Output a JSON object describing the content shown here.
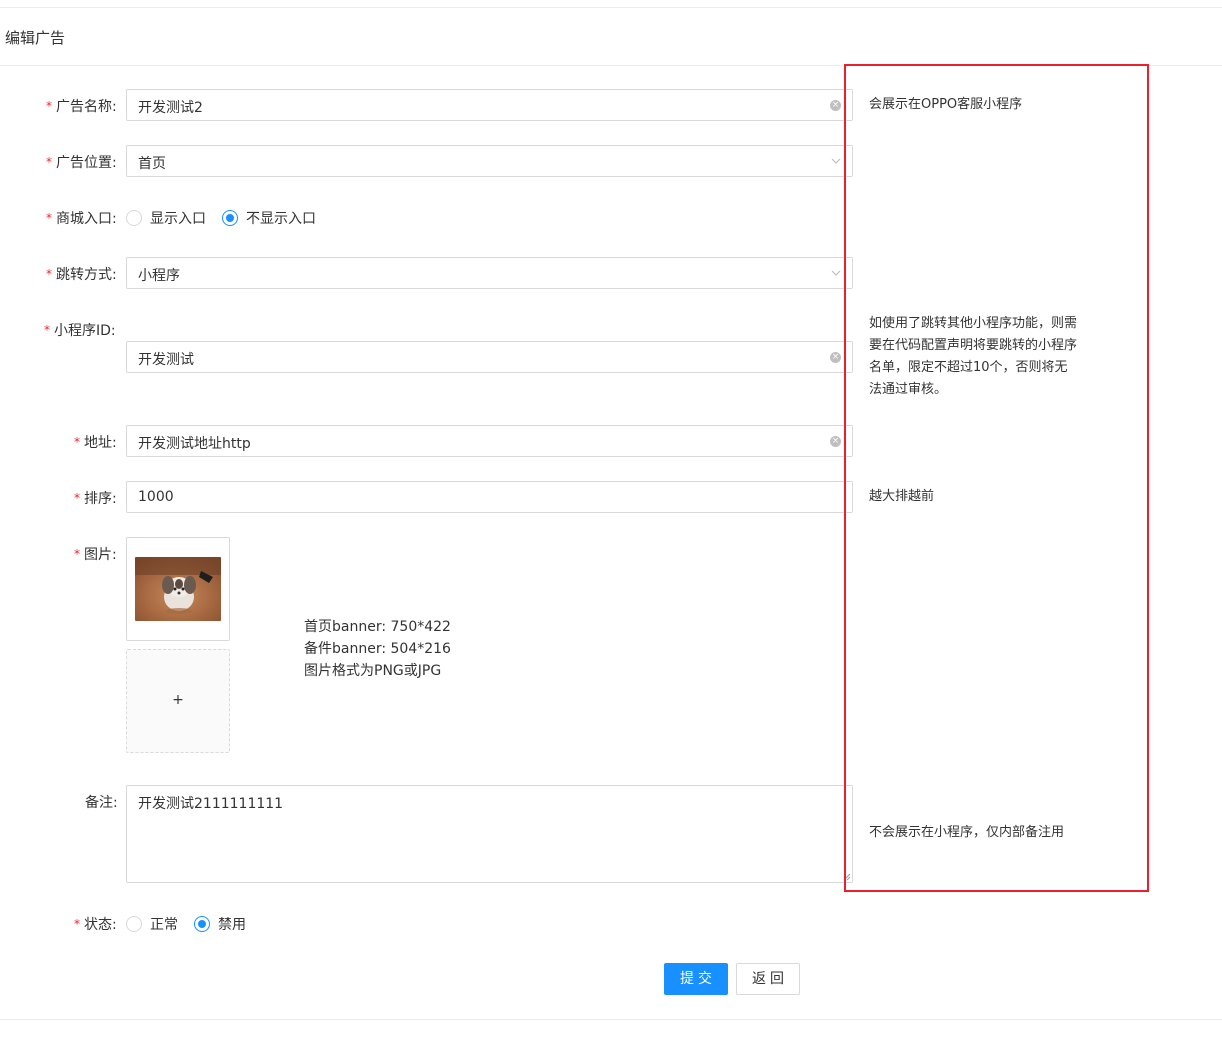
{
  "header": {
    "title": "编辑广告"
  },
  "form": {
    "ad_name": {
      "label": "广告名称:",
      "value": "开发测试2",
      "hint": "会展示在OPPO客服小程序"
    },
    "ad_position": {
      "label": "广告位置:",
      "value": "首页"
    },
    "mall_entry": {
      "label": "商城入口:",
      "options": [
        "显示入口",
        "不显示入口"
      ],
      "selected": "不显示入口"
    },
    "jump_type": {
      "label": "跳转方式:",
      "value": "小程序"
    },
    "mini_program_id": {
      "label": "小程序ID:",
      "value": "开发测试",
      "hint_lines": [
        "如使用了跳转其他小程序功能，则需",
        "要在代码配置声明将要跳转的小程序",
        "名单，限定不超过10个，否则将无",
        "法通过审核。"
      ]
    },
    "address": {
      "label": "地址:",
      "value": "开发测试地址http"
    },
    "sort": {
      "label": "排序:",
      "value": "1000",
      "hint": "越大排越前"
    },
    "image": {
      "label": "图片:",
      "upload_plus": "+",
      "notes": [
        "首页banner: 750*422",
        "备件banner: 504*216",
        "图片格式为PNG或JPG"
      ]
    },
    "remark": {
      "label": "备注:",
      "value": "开发测试2111111111",
      "hint": "不会展示在小程序，仅内部备注用"
    },
    "status": {
      "label": "状态:",
      "options": [
        "正常",
        "禁用"
      ],
      "selected": "禁用"
    }
  },
  "required_mark": "*",
  "buttons": {
    "submit": "提交",
    "back": "返回"
  },
  "colors": {
    "primary": "#1890ff",
    "required": "#f5222d",
    "annotation_box": "#e8212c"
  },
  "icons": {
    "clear": "clear-circle-icon",
    "dropdown": "chevron-down-icon"
  }
}
